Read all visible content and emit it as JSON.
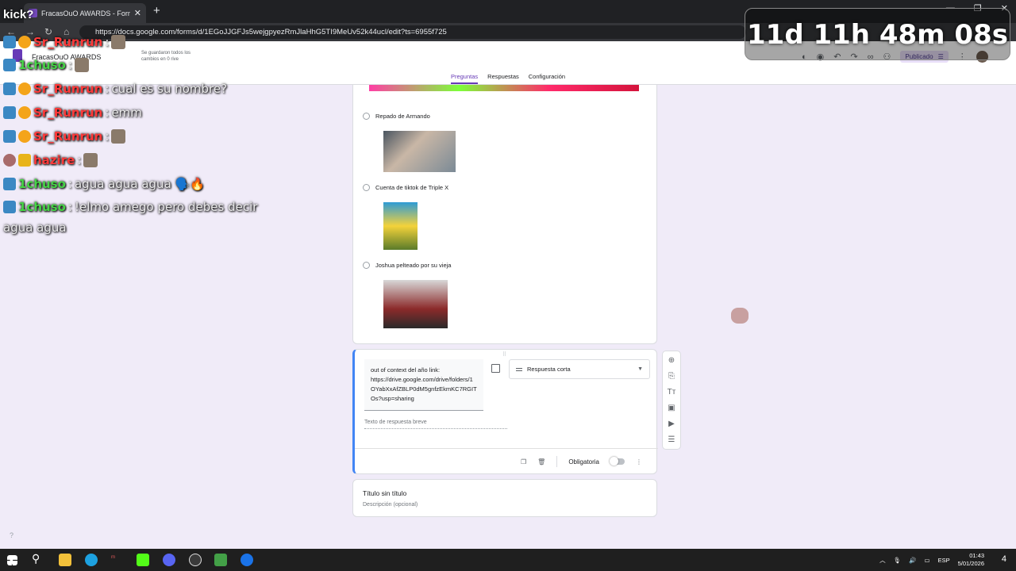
{
  "browser": {
    "tab_title": "FracasOuO AWARDS - Formulario",
    "tab_close": "✕",
    "new_tab": "+",
    "url": "https://docs.google.com/forms/d/1EGoJJGFJs5wejgpyezRmJlaHhG5TI9MeUv52k44ucl/edit?ts=6955f725",
    "win_controls": [
      "—",
      "❐",
      "✕"
    ]
  },
  "forms": {
    "title": "FracasOuO AWARDS",
    "saved_note": "Se guardaron todos los cambios en 0 rive",
    "publish_label": "Publicado",
    "tabs": [
      "Preguntas",
      "Respuestas",
      "Configuración"
    ]
  },
  "options": [
    {
      "label": "Repado de Armando"
    },
    {
      "label": "Cuenta de tiktok de Triple X"
    },
    {
      "label": "Joshua pelteado por su vieja"
    }
  ],
  "question": {
    "title": "out of context del año link: https://drive.google.com/drive/folders/1OYabXxAfZBLP0dM5gnfzEkmKC7RGITOs?usp=sharing",
    "type_label": "Respuesta corta",
    "short_answer_placeholder": "Texto de respuesta breve",
    "required_label": "Obligatoria"
  },
  "section": {
    "title": "Título sin título",
    "description": "Descripción (opcional)"
  },
  "overlay": {
    "timer": "11d 11h 48m 08s",
    "kick_text": "kick?",
    "chat": [
      {
        "user": "Sr_Runrun",
        "sep": " : ",
        "msg": "",
        "user_color": "red"
      },
      {
        "user": "1chuso",
        "sep": " : ",
        "msg": "",
        "user_color": "green"
      },
      {
        "user": "Sr_Runrun",
        "sep": " : ",
        "msg": "cual es su nombre?",
        "user_color": "red"
      },
      {
        "user": "Sr_Runrun",
        "sep": " : ",
        "msg": "emm",
        "user_color": "red"
      },
      {
        "user": "Sr_Runrun",
        "sep": " : ",
        "msg": "",
        "user_color": "red"
      },
      {
        "user": "hazire",
        "sep": " : ",
        "msg": "",
        "user_color": "red"
      },
      {
        "user": "1chuso",
        "sep": " : ",
        "msg": "agua agua agua 🗣️🔥",
        "user_color": "green"
      },
      {
        "user": "1chuso",
        "sep": " : ",
        "msg": "!elmo amego pero debes decir",
        "user_color": "green"
      }
    ],
    "chat_wrap": "agua agua"
  },
  "taskbar": {
    "language": "ESP",
    "time": "01:43",
    "date": "5/01/2026",
    "notifications": "4"
  }
}
